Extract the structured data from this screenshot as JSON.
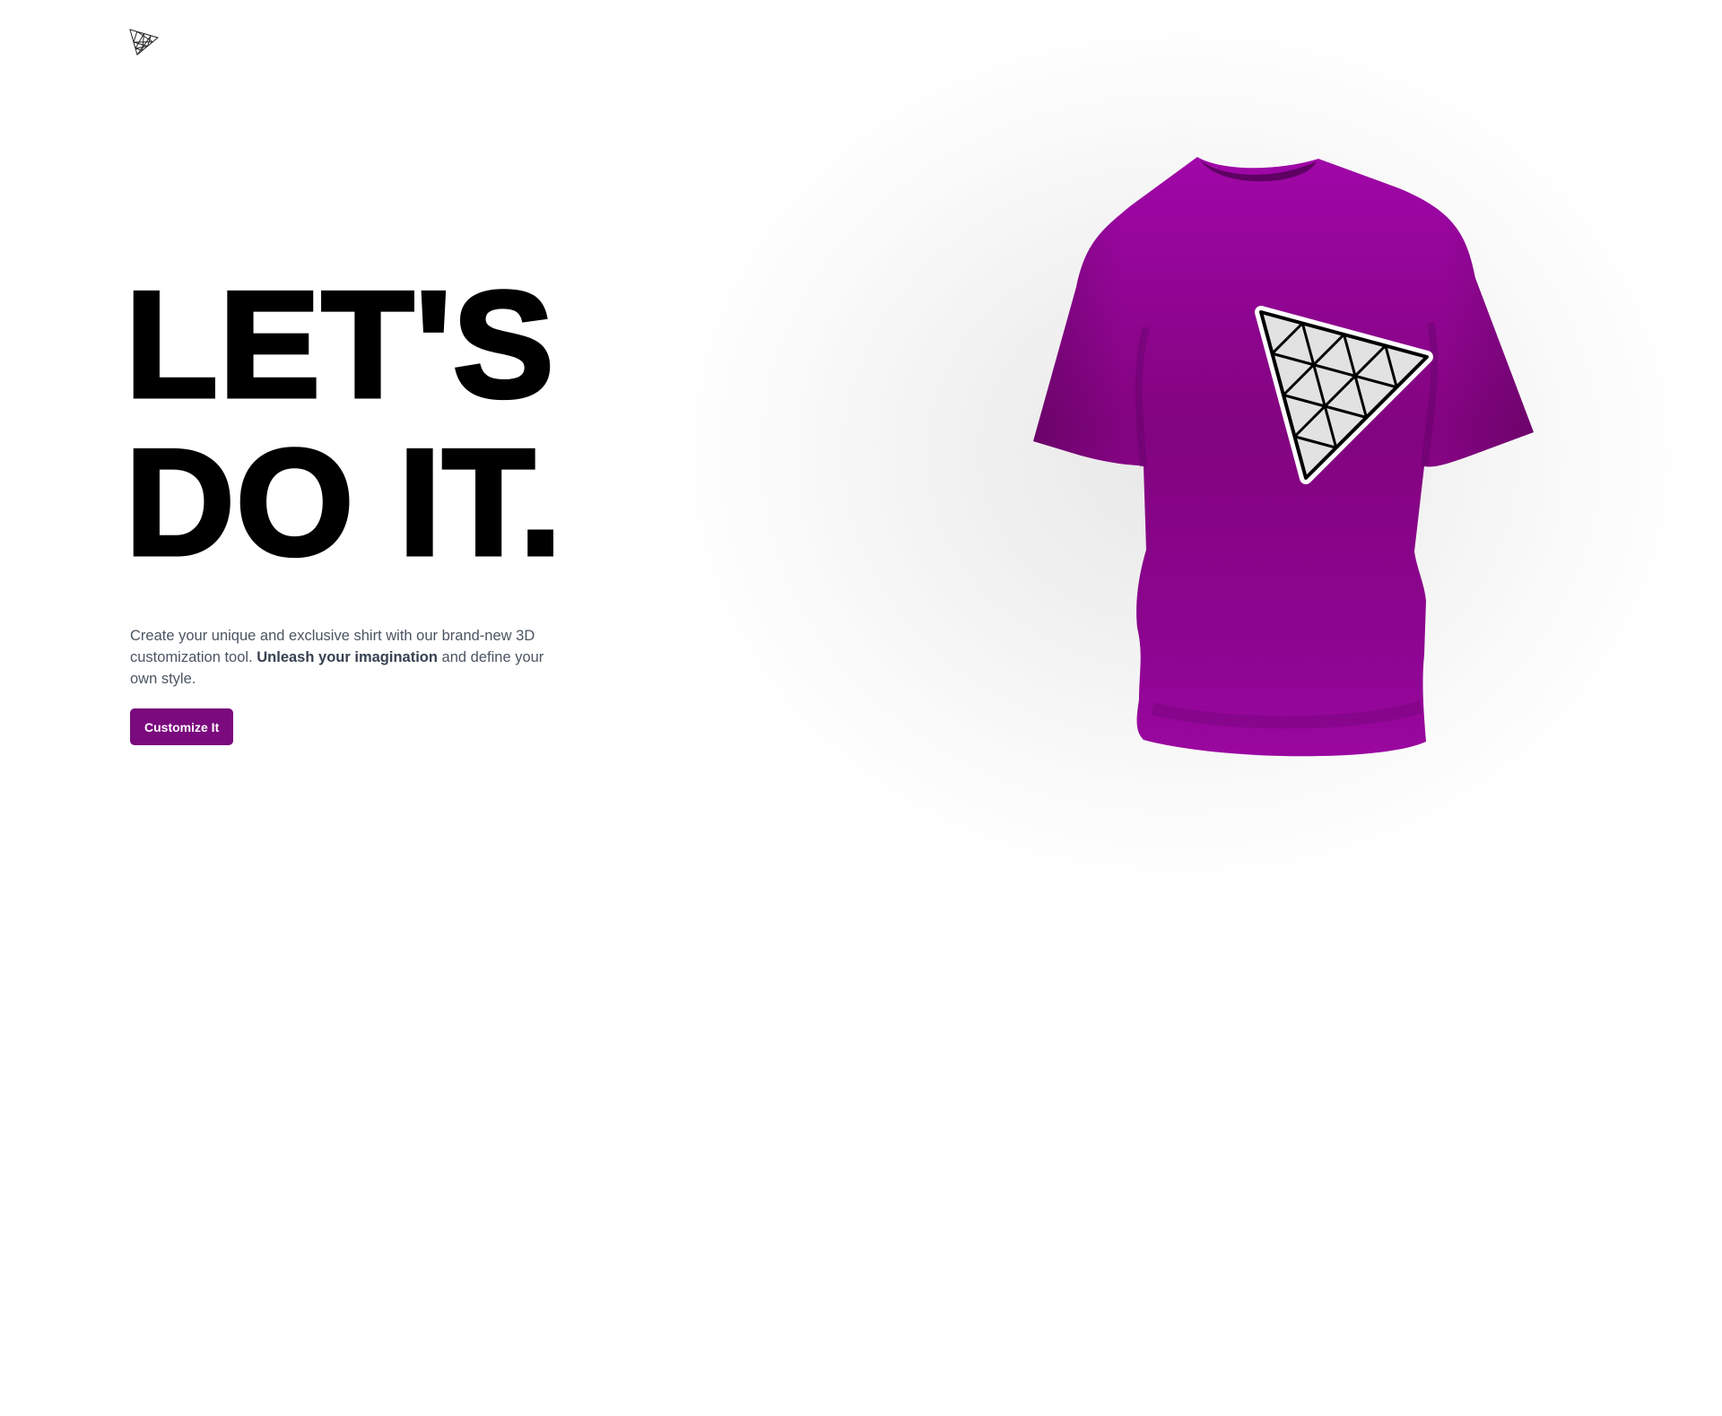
{
  "brand": {
    "logo_icon": "threejs-triangle-logo-icon"
  },
  "hero": {
    "headline_line1": "LET'S",
    "headline_line2": "DO IT.",
    "description_prefix": "Create your unique and exclusive shirt with our brand-new 3D customization tool.",
    "description_emphasis": "Unleash your imagination",
    "description_suffix": "and define your own style.",
    "cta_label": "Customize It"
  },
  "shirt_preview": {
    "icon": "tshirt-3d-model-icon",
    "decal_icon": "threejs-triangle-decal-icon",
    "shirt_color": "#8f0596",
    "decal_fill": "#e2e2e2",
    "decal_stroke": "#000000"
  },
  "colors": {
    "accent": "#7a0a7d",
    "heading": "#000000",
    "body_text": "#4b5563"
  }
}
